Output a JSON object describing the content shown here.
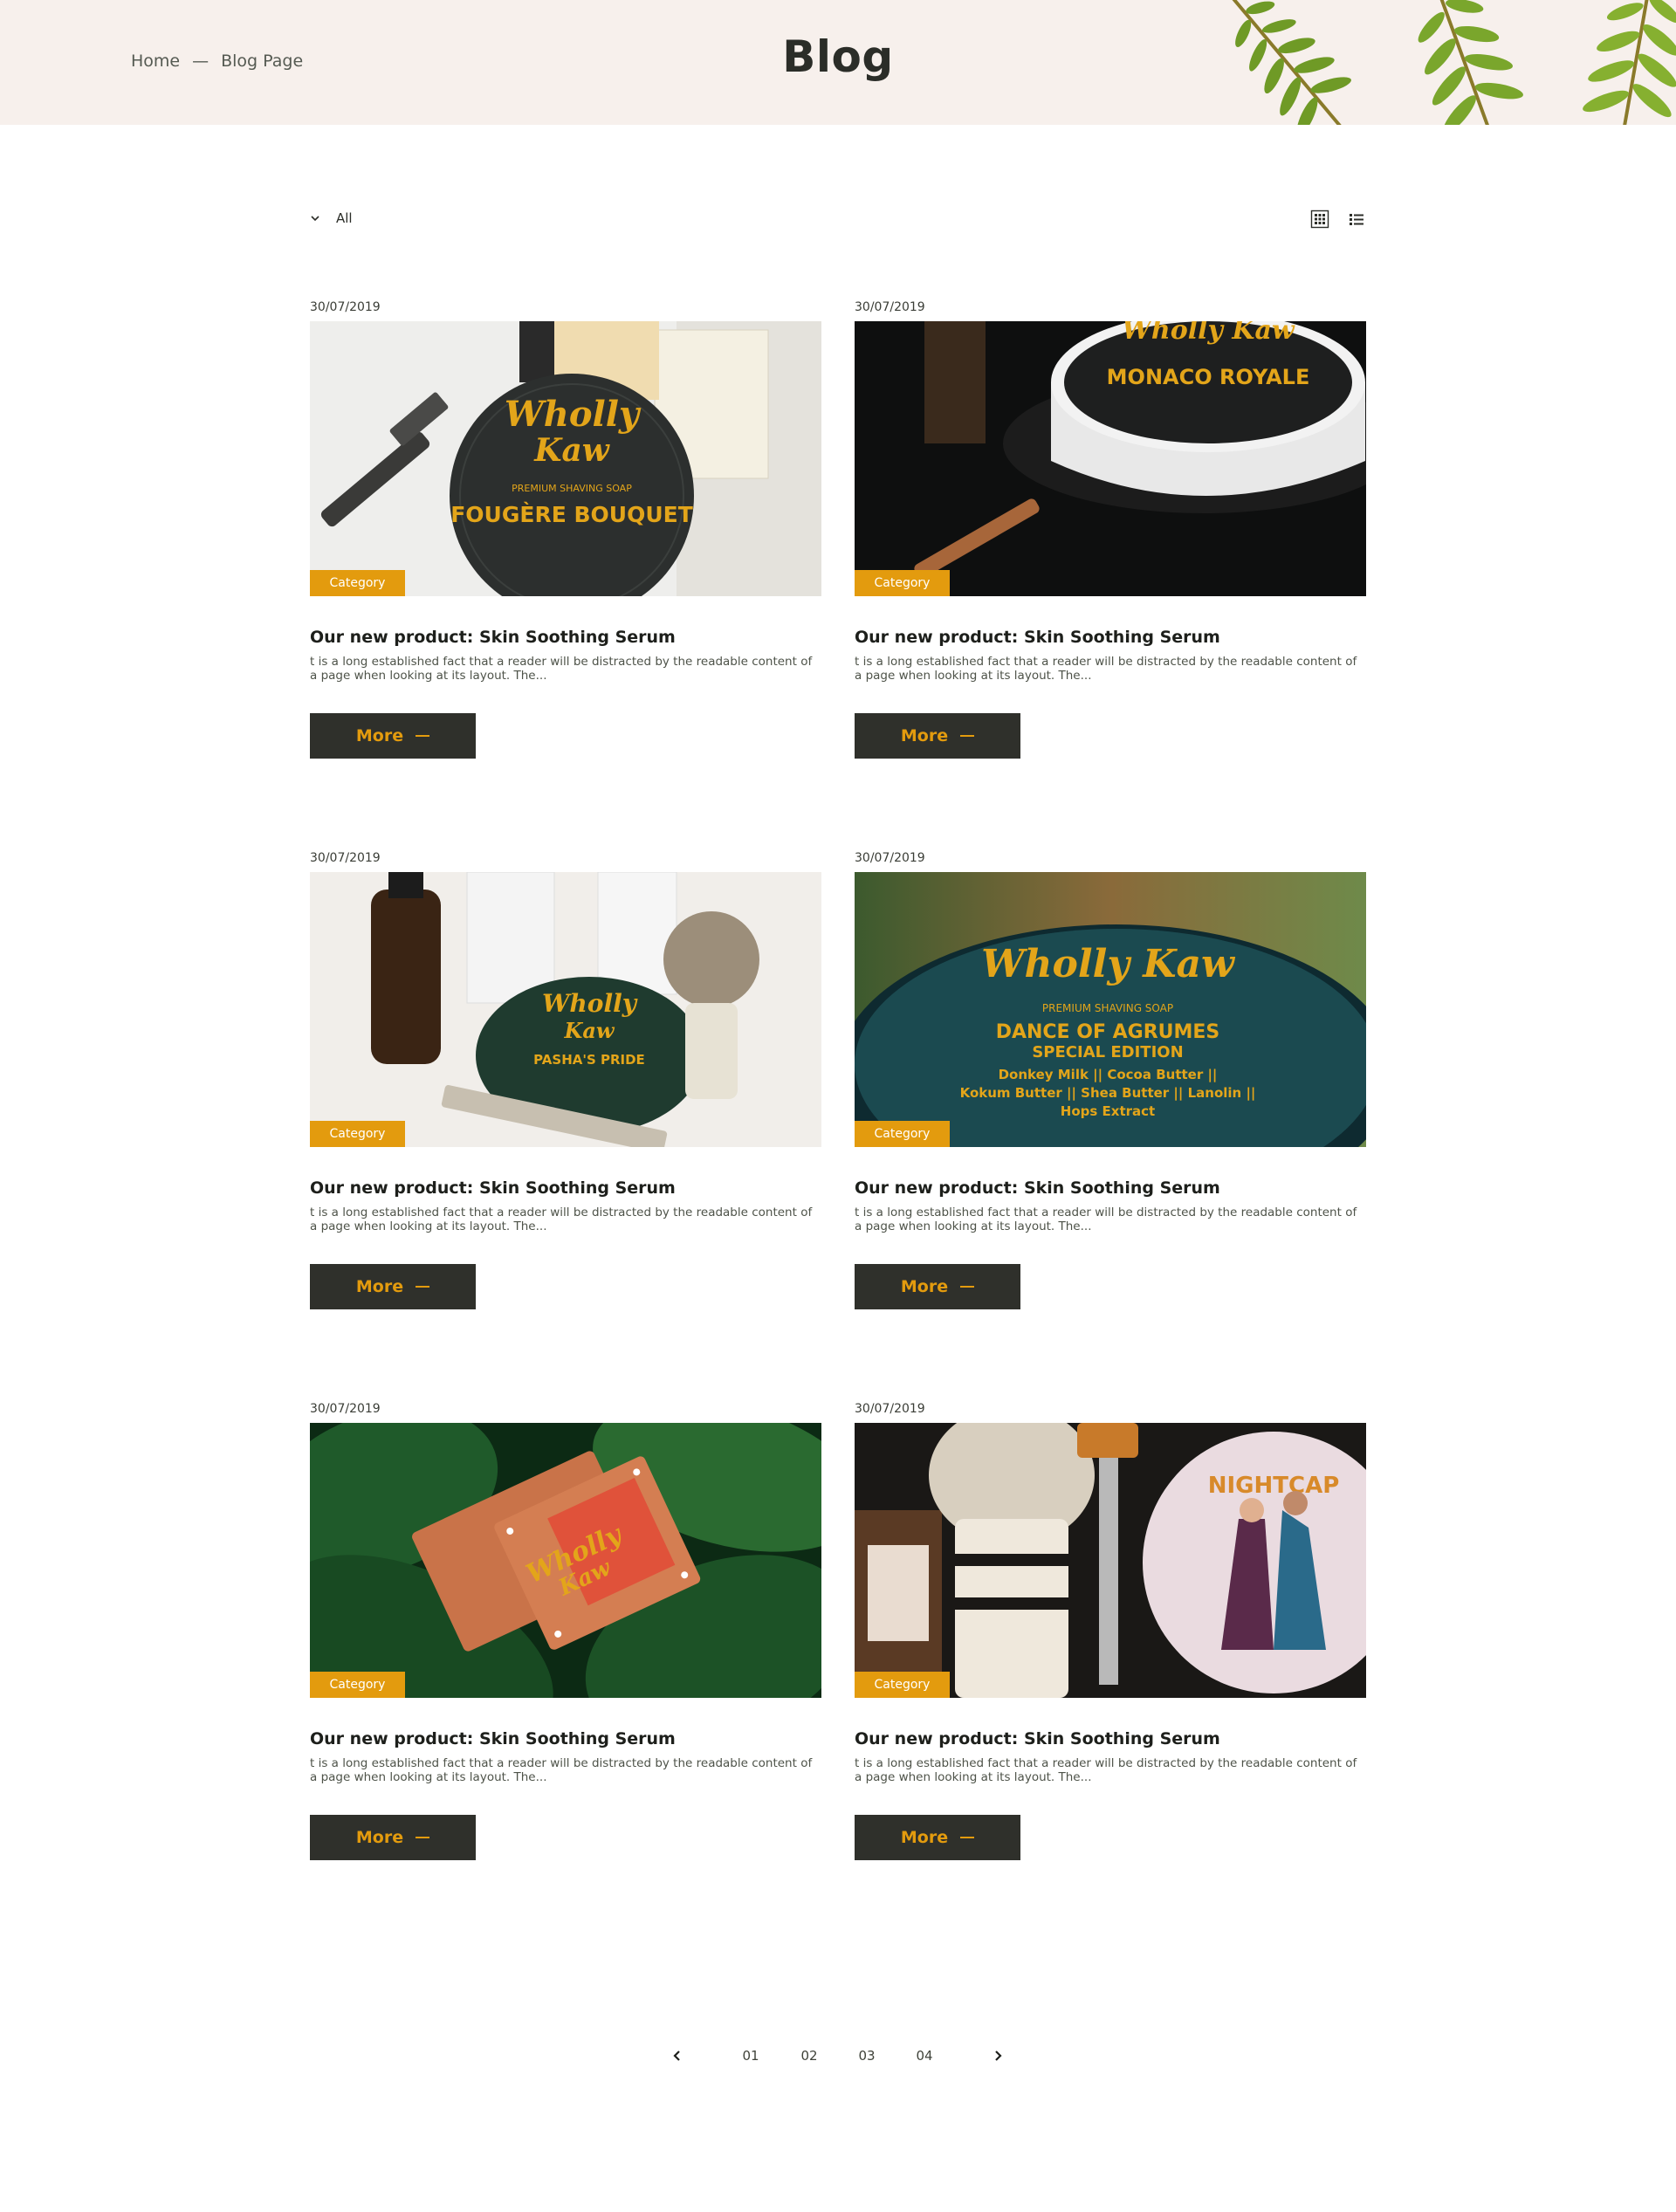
{
  "breadcrumb": {
    "home": "Home",
    "separator": "—",
    "current": "Blog Page"
  },
  "page": {
    "title": "Blog"
  },
  "toolbar": {
    "filter_value": "All",
    "filter_icon": "chevron-down-icon",
    "view_grid_icon": "grid-view-icon",
    "view_list_icon": "list-view-icon"
  },
  "colors": {
    "accent": "#e39b0e",
    "dark": "#2f302b",
    "header_bg": "#f7f0ec"
  },
  "posts": [
    {
      "date": "30/07/2019",
      "category": "Category",
      "title": "Our new product: Skin Soothing Serum",
      "excerpt": "t is a long established fact that a reader will be distracted by the readable content of a page when looking at its layout. The...",
      "more": "More",
      "image": "shaving-soap-fougere-bouquet"
    },
    {
      "date": "30/07/2019",
      "category": "Category",
      "title": "Our new product: Skin Soothing Serum",
      "excerpt": "t is a long established fact that a reader will be distracted by the readable content of a page when looking at its layout. The...",
      "more": "More",
      "image": "shaving-soap-monaco-royale"
    },
    {
      "date": "30/07/2019",
      "category": "Category",
      "title": "Our new product: Skin Soothing Serum",
      "excerpt": "t is a long established fact that a reader will be distracted by the readable content of a page when looking at its layout. The...",
      "more": "More",
      "image": "shaving-soap-pashas-pride"
    },
    {
      "date": "30/07/2019",
      "category": "Category",
      "title": "Our new product: Skin Soothing Serum",
      "excerpt": "t is a long established fact that a reader will be distracted by the readable content of a page when looking at its layout. The...",
      "more": "More",
      "image": "shaving-soap-dance-of-agrumes"
    },
    {
      "date": "30/07/2019",
      "category": "Category",
      "title": "Our new product: Skin Soothing Serum",
      "excerpt": "t is a long established fact that a reader will be distracted by the readable content of a page when looking at its layout. The...",
      "more": "More",
      "image": "wooden-soap-case-on-leaves"
    },
    {
      "date": "30/07/2019",
      "category": "Category",
      "title": "Our new product: Skin Soothing Serum",
      "excerpt": "t is a long established fact that a reader will be distracted by the readable content of a page when looking at its layout. The...",
      "more": "More",
      "image": "shaving-brush-nightcap"
    }
  ],
  "pagination": {
    "prev_icon": "chevron-left-icon",
    "next_icon": "chevron-right-icon",
    "pages": [
      "01",
      "02",
      "03",
      "04"
    ]
  }
}
